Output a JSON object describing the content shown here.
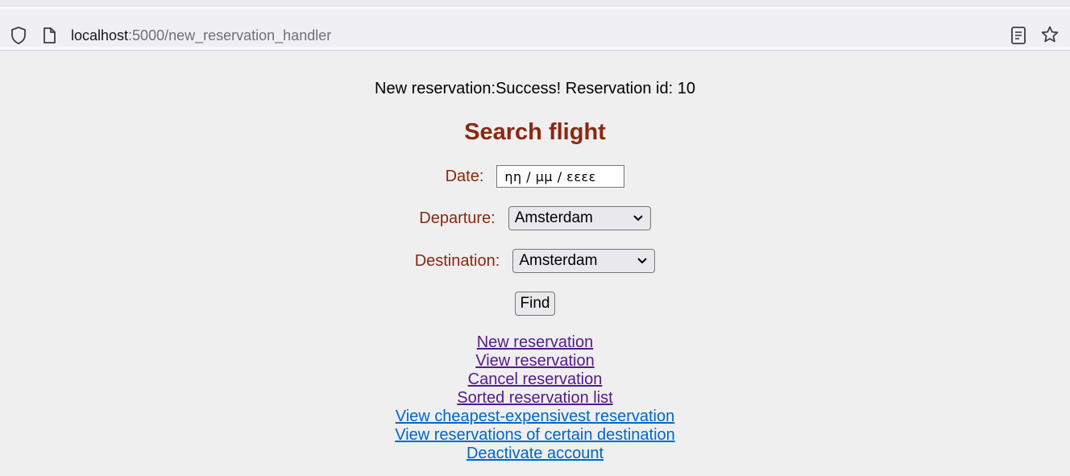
{
  "browser": {
    "url_host": "localhost",
    "url_rest": ":5000/new_reservation_handler"
  },
  "page": {
    "message": "New reservation:Success! Reservation id: 10",
    "title": "Search flight",
    "form": {
      "date_label": "Date:",
      "date_value": "ηη / μμ / εεεε",
      "departure_label": "Departure:",
      "departure_value": "Amsterdam",
      "destination_label": "Destination:",
      "destination_value": "Amsterdam",
      "find_label": "Find"
    },
    "links": [
      {
        "label": "New reservation",
        "visited": true
      },
      {
        "label": "View reservation",
        "visited": true
      },
      {
        "label": "Cancel reservation",
        "visited": true
      },
      {
        "label": "Sorted reservation list",
        "visited": true
      },
      {
        "label": "View cheapest-expensivest reservation",
        "visited": false
      },
      {
        "label": "View reservations of certain destination",
        "visited": false
      },
      {
        "label": "Deactivate account",
        "visited": false
      }
    ]
  },
  "colors": {
    "title": "#8b2711",
    "visited_link": "#551a8b",
    "unvisited_link": "#0066cc"
  }
}
